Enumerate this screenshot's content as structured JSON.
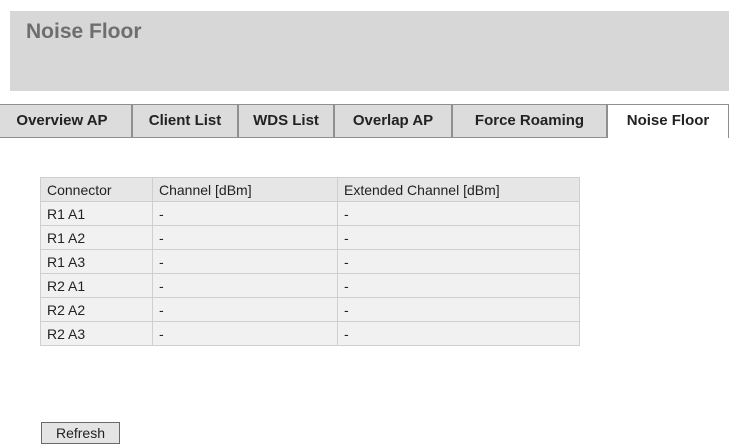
{
  "page": {
    "title": "Noise Floor"
  },
  "tabs": [
    {
      "label": "Overview AP"
    },
    {
      "label": "Client List"
    },
    {
      "label": "WDS List"
    },
    {
      "label": "Overlap AP"
    },
    {
      "label": "Force Roaming"
    },
    {
      "label": "Noise Floor",
      "active": true
    }
  ],
  "table": {
    "headers": [
      "Connector",
      "Channel [dBm]",
      "Extended Channel [dBm]"
    ],
    "rows": [
      [
        "R1 A1",
        "-",
        "-"
      ],
      [
        "R1 A2",
        "-",
        "-"
      ],
      [
        "R1 A3",
        "-",
        "-"
      ],
      [
        "R2 A1",
        "-",
        "-"
      ],
      [
        "R2 A2",
        "-",
        "-"
      ],
      [
        "R2 A3",
        "-",
        "-"
      ]
    ]
  },
  "actions": {
    "refresh_label": "Refresh"
  }
}
